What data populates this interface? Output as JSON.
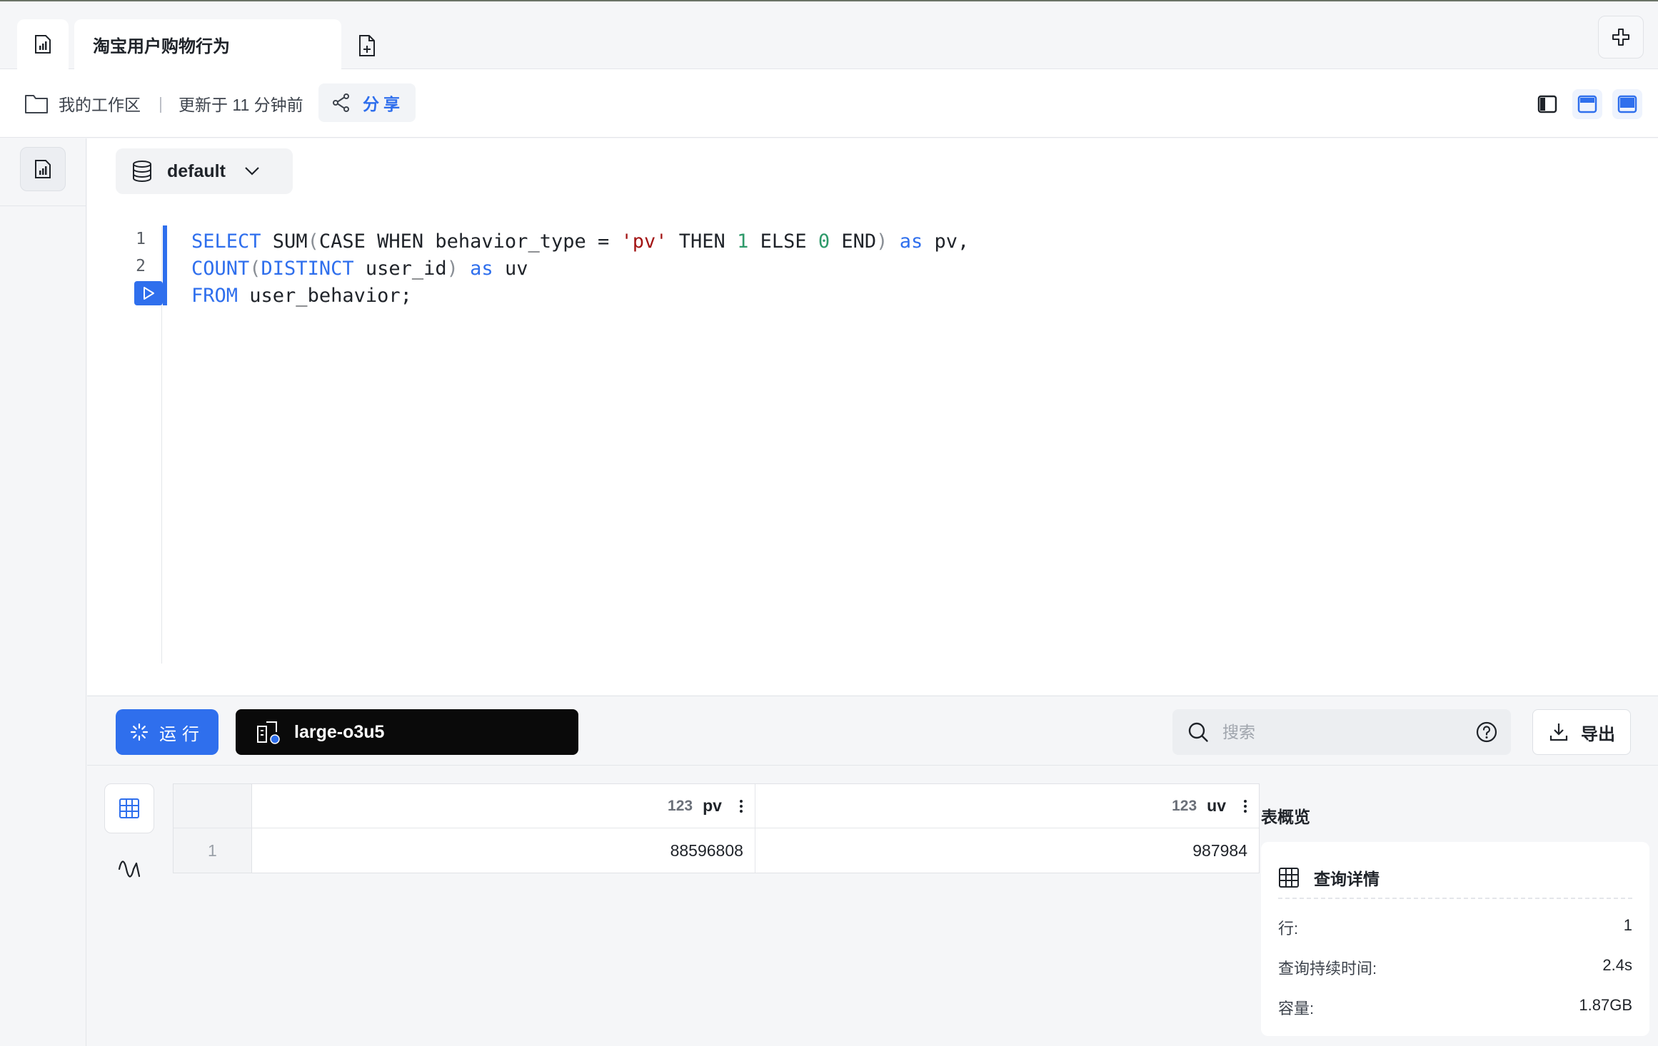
{
  "tabs": {
    "active_title": "淘宝用户购物行为"
  },
  "breadcrumb": {
    "workspace": "我的工作区",
    "separator": "|",
    "updated": "更新于 11 分钟前",
    "share_label": "分享"
  },
  "editor": {
    "database": "default",
    "line_numbers": [
      "1",
      "2"
    ]
  },
  "toolbar": {
    "run_label": "运行",
    "cluster": "large-o3u5",
    "search_placeholder": "搜索",
    "export_label": "导出"
  },
  "results": {
    "columns": [
      {
        "type": "123",
        "name": "pv"
      },
      {
        "type": "123",
        "name": "uv"
      }
    ],
    "rows": [
      {
        "index": "1",
        "values": [
          "88596808",
          "987984"
        ]
      }
    ]
  },
  "overview": {
    "title": "表概览",
    "card_title": "查询详情",
    "rows": [
      {
        "label": "行:",
        "value": "1"
      },
      {
        "label": "查询持续时间:",
        "value": "2.4s"
      },
      {
        "label": "容量:",
        "value": "1.87GB"
      }
    ]
  },
  "colors": {
    "accent": "#2f6fed",
    "cluster_bg": "#0a0a0a"
  },
  "icons": [
    "report-icon",
    "new-file-icon",
    "split-icon",
    "folder-icon",
    "share-icon",
    "layout-left-icon",
    "layout-top-icon",
    "layout-bottom-icon",
    "database-icon",
    "chevron-down-icon",
    "play-icon",
    "loading-icon",
    "cluster-icon",
    "search-icon",
    "help-icon",
    "download-icon",
    "table-icon",
    "chart-icon",
    "kebab-icon"
  ]
}
